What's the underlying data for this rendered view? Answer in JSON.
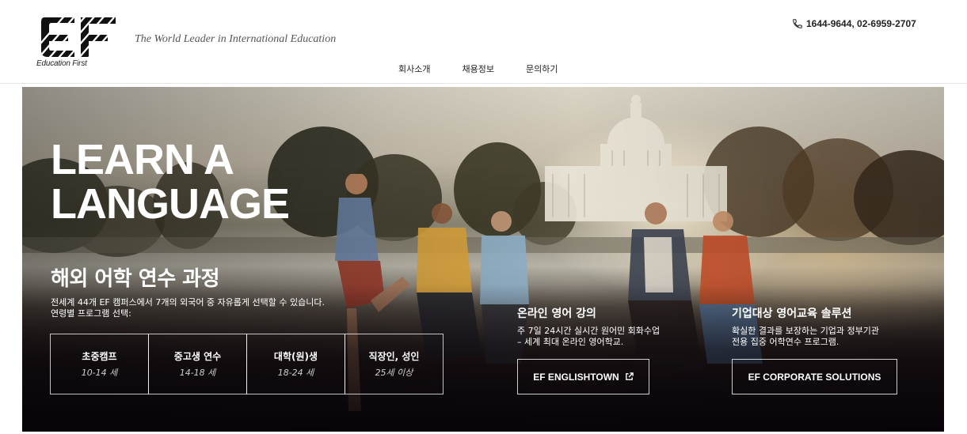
{
  "header": {
    "logo_text": "Education First",
    "tagline": "The World Leader in International Education",
    "phone": "1644-9644, 02-6959-2707",
    "nav": [
      "회사소개",
      "채용정보",
      "문의하기"
    ]
  },
  "hero": {
    "title_line1": "LEARN A",
    "title_line2": "LANGUAGE",
    "course_title": "해외 어학 연수 과정",
    "course_desc_line1": "전세계 44개 EF 캠퍼스에서 7개의 외국어 중 자유롭게 선택할 수 있습니다.",
    "course_desc_line2": "연령별 프로그램 선택:",
    "programs": [
      {
        "name": "초중캠프",
        "age": "10-14 세"
      },
      {
        "name": "중고생 연수",
        "age": "14-18 세"
      },
      {
        "name": "대학(원)생",
        "age": "18-24 세"
      },
      {
        "name": "직장인, 성인",
        "age": "25세 이상"
      }
    ],
    "online": {
      "title": "온라인 영어 강의",
      "desc_line1": "주 7일 24시간 실시간 원어민 회화수업",
      "desc_line2": "– 세계 최대 온라인 영어학교.",
      "button": "EF ENGLISHTOWN"
    },
    "corporate": {
      "title": "기업대상 영어교육 솔루션",
      "desc_line1": "확실한 결과를 보장하는 기업과 정부기관",
      "desc_line2": "전용 집중 어학연수 프로그램.",
      "button": "EF CORPORATE SOLUTIONS"
    }
  },
  "icons": {
    "phone": "phone-icon",
    "external": "external-link-icon",
    "logo": "ef-logo-icon"
  }
}
